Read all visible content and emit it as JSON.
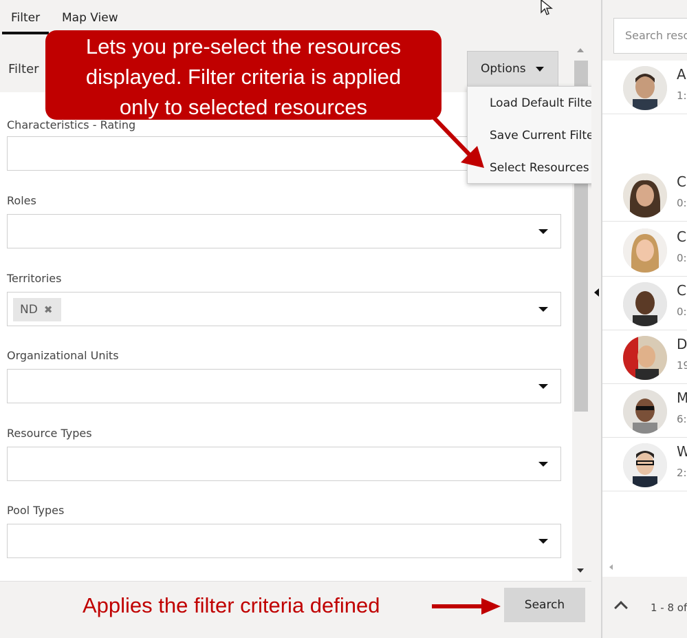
{
  "tabs": [
    {
      "label": "Filter"
    },
    {
      "label": "Map View"
    }
  ],
  "filter_header": {
    "title": "Filter"
  },
  "options_button": {
    "label": "Options"
  },
  "options_menu": {
    "items": [
      {
        "label": "Load Default Filters"
      },
      {
        "label": "Save Current Filters as Default"
      },
      {
        "label": "Select Resources"
      }
    ]
  },
  "fields": {
    "characteristics": {
      "label": "Characteristics - Rating"
    },
    "roles": {
      "label": "Roles"
    },
    "territories": {
      "label": "Territories",
      "chip": "ND",
      "chip_remove": "✖"
    },
    "org_units": {
      "label": "Organizational Units"
    },
    "resource_types": {
      "label": "Resource Types"
    },
    "pool_types": {
      "label": "Pool Types"
    }
  },
  "search_button": {
    "label": "Search"
  },
  "right_panel": {
    "search_placeholder": "Search resources",
    "resources": [
      {
        "initial": "A",
        "meta": "1:"
      },
      {
        "initial": "C",
        "meta": "0:"
      },
      {
        "initial": "C",
        "meta": "0:"
      },
      {
        "initial": "C",
        "meta": "0:"
      },
      {
        "initial": "D",
        "meta": "19"
      },
      {
        "initial": "M",
        "meta": "6:"
      },
      {
        "initial": "W",
        "meta": "2:"
      }
    ],
    "pager_text": "1 - 8 of"
  },
  "annotations": {
    "callout_lines": [
      "Lets you pre-select the resources",
      "displayed.  Filter criteria is applied",
      "only to selected resources"
    ],
    "applies_text": "Applies the filter criteria defined"
  },
  "colors": {
    "annotation_red": "#c00000",
    "panel_bg": "#f3f2f1"
  }
}
